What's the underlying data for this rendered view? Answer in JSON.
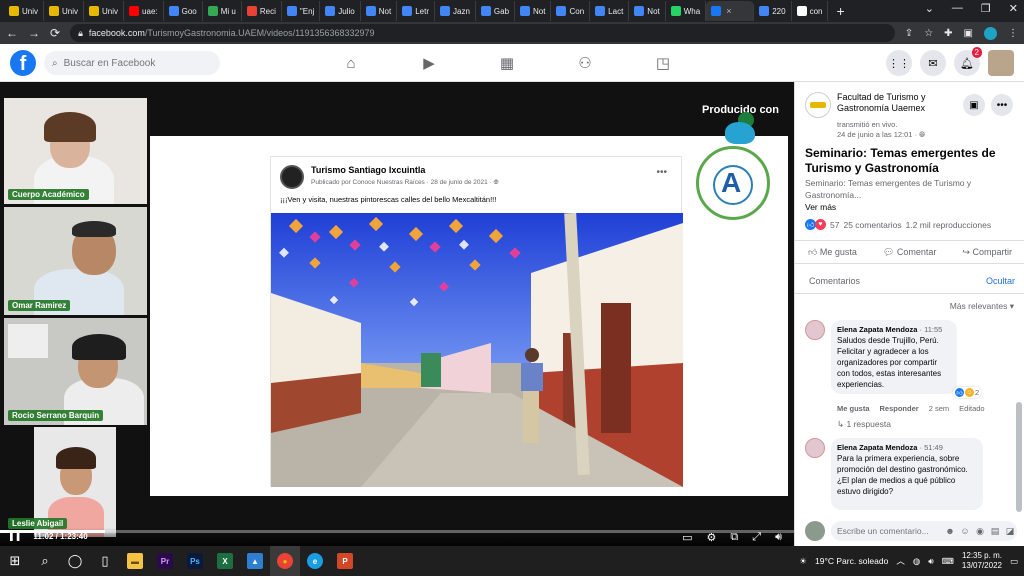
{
  "browser": {
    "tabs": [
      {
        "label": "Univ",
        "color": "#e6b800"
      },
      {
        "label": "Univ",
        "color": "#e6b800"
      },
      {
        "label": "Univ",
        "color": "#e6b800"
      },
      {
        "label": "uae:",
        "color": "#ff0000"
      },
      {
        "label": "Goo",
        "color": "#4285f4"
      },
      {
        "label": "Mi u",
        "color": "#34a853"
      },
      {
        "label": "Reci",
        "color": "#ea4335"
      },
      {
        "label": "\"Enj",
        "color": "#4285f4"
      },
      {
        "label": "Julio",
        "color": "#4285f4"
      },
      {
        "label": "Not",
        "color": "#4285f4"
      },
      {
        "label": "Letr",
        "color": "#4285f4"
      },
      {
        "label": "Jazn",
        "color": "#4285f4"
      },
      {
        "label": "Gab",
        "color": "#4285f4"
      },
      {
        "label": "Not",
        "color": "#4285f4"
      },
      {
        "label": "Con",
        "color": "#4285f4"
      },
      {
        "label": "Lact",
        "color": "#4285f4"
      },
      {
        "label": "Not",
        "color": "#4285f4"
      },
      {
        "label": "Wha",
        "color": "#25d366"
      }
    ],
    "active_tab_color": "#1877f2",
    "tabs_after": [
      {
        "label": "220",
        "color": "#4285f4"
      },
      {
        "label": "con",
        "color": "#ffffff"
      }
    ],
    "new_tab": "+",
    "url_host": "facebook.com",
    "url_path": "/TurismoyGastronomia.UAEM/videos/1191356368332979"
  },
  "fb": {
    "search_placeholder": "Buscar en Facebook",
    "notifications_count": "2"
  },
  "video": {
    "produced_with": "Producido con",
    "participants": [
      {
        "name": "Cuerpo Académico"
      },
      {
        "name": "Omar Ramirez"
      },
      {
        "name": "Rocio Serrano Barquin"
      },
      {
        "name": "Leslie Abigail"
      }
    ],
    "slide": {
      "page_name": "Turismo Santiago Ixcuintla",
      "meta_prefix": "Publicado por Conoce Nuestras Raíces",
      "meta_date": "28 de junio de 2021",
      "post_text": "¡¡¡Ven y visita, nuestras pintorescas calles del bello Mexcaltitán!!!"
    },
    "time_current": "11:02",
    "time_total": "1:23:40",
    "progress": 0.132
  },
  "panel": {
    "page_name": "Facultad de Turismo y Gastronomía Uaemex",
    "meta_line1": "transmitió en vivo.",
    "meta_line2": "24 de junio a las 12:01",
    "title": "Seminario: Temas emergentes de Turismo y Gastronomía",
    "desc": "Seminario: Temas emergentes de Turismo y Gastronomía...",
    "see_more": "Ver más",
    "reaction_count": "57",
    "comments_count": "25 comentarios",
    "views": "1.2 mil reproducciones",
    "like": "Me gusta",
    "comment": "Comentar",
    "share": "Compartir",
    "comments_label": "Comentarios",
    "hide": "Ocultar",
    "sort": "Más relevantes",
    "comments": [
      {
        "author": "Elena Zapata Mendoza",
        "time": "11:55",
        "text": "Saludos desde Trujillo, Perú. Felicitar y agradecer a los organizadores por compartir con todos, estas interesantes experiencias.",
        "reactions": "2",
        "like": "Me gusta",
        "reply": "Responder",
        "age": "2 sem",
        "edited": "Editado",
        "replies": "1 respuesta"
      },
      {
        "author": "Elena Zapata Mendoza",
        "time": "51:49",
        "text": "Para la primera experiencia, sobre promoción del destino gastronómico.¿El plan de medios a qué público estuvo dirigido?"
      }
    ],
    "comment_placeholder": "Escribe un comentario..."
  },
  "taskbar": {
    "weather": "19°C  Parc. soleado",
    "time": "12:35 p. m.",
    "date": "13/07/2022"
  }
}
